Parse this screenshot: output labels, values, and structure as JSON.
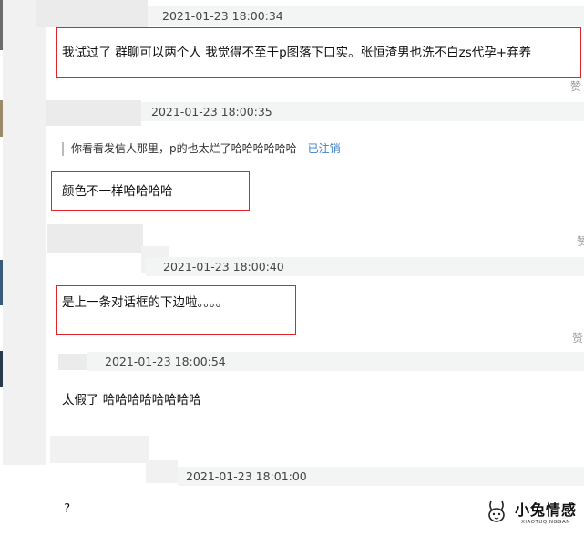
{
  "messages": [
    {
      "timestamp": "2021-01-23 18:00:34",
      "text": "我试过了 群聊可以两个人 我觉得不至于p图落下口实。张恒渣男也洗不白zs代孕+弃养",
      "like": "赞"
    },
    {
      "timestamp": "2021-01-23 18:00:35",
      "quote": "你看看发信人那里，p的也太烂了哈哈哈哈哈哈",
      "quote_status": "已注销",
      "text": "颜色不一样哈哈哈哈",
      "like": "赞"
    },
    {
      "timestamp": "2021-01-23 18:00:40",
      "text": "是上一条对话框的下边啦。。。。",
      "like": "赞"
    },
    {
      "timestamp": "2021-01-23 18:00:54",
      "text": "太假了 哈哈哈哈哈哈哈哈"
    },
    {
      "timestamp": "2021-01-23 18:01:00",
      "text": "?"
    }
  ],
  "watermark": {
    "name": "小兔情感",
    "sub": "XIAOTUQINGGAN"
  },
  "colors": {
    "highlight": "#e0222b",
    "link": "#3b7fc4",
    "timestamp_bar": "#f2f5f3"
  }
}
